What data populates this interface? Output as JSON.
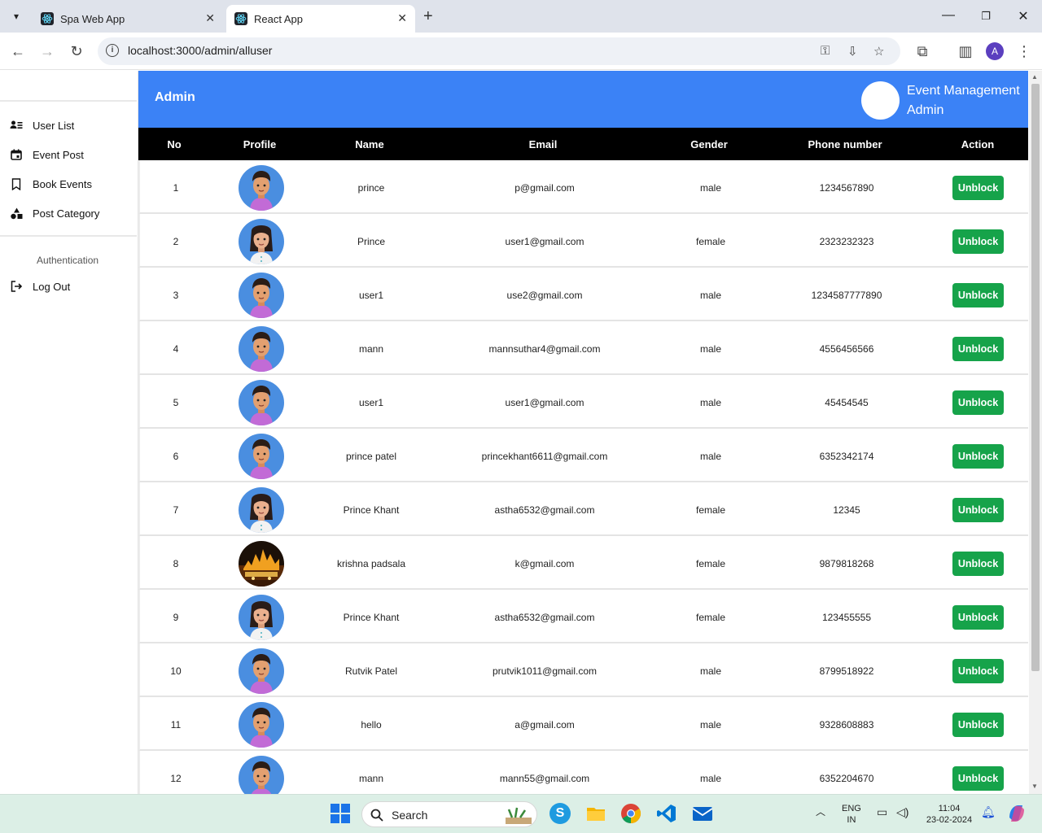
{
  "browser": {
    "tabs": [
      {
        "title": "Spa Web App",
        "active": false
      },
      {
        "title": "React App",
        "active": true
      }
    ],
    "url": "localhost:3000/admin/alluser",
    "profile_initial": "A"
  },
  "sidebar": {
    "items": [
      {
        "label": "User List",
        "icon": "user-list-icon"
      },
      {
        "label": "Event Post",
        "icon": "calendar-icon"
      },
      {
        "label": "Book Events",
        "icon": "bookmark-icon"
      },
      {
        "label": "Post Category",
        "icon": "shapes-icon"
      }
    ],
    "section_label": "Authentication",
    "logout_label": "Log Out"
  },
  "header": {
    "title": "Admin",
    "brand_line1": "Event Management",
    "brand_line2": "Admin"
  },
  "table": {
    "columns": [
      "No",
      "Profile",
      "Name",
      "Email",
      "Gender",
      "Phone number",
      "Action"
    ],
    "action_label": "Unblock",
    "rows": [
      {
        "no": "1",
        "avatar": "boy",
        "name": "prince",
        "email": "p@gmail.com",
        "gender": "male",
        "phone": "1234567890"
      },
      {
        "no": "2",
        "avatar": "girl",
        "name": "Prince",
        "email": "user1@gmail.com",
        "gender": "female",
        "phone": "2323232323"
      },
      {
        "no": "3",
        "avatar": "boy",
        "name": "user1",
        "email": "use2@gmail.com",
        "gender": "male",
        "phone": "1234587777890"
      },
      {
        "no": "4",
        "avatar": "boy",
        "name": "mann",
        "email": "mannsuthar4@gmail.com",
        "gender": "male",
        "phone": "4556456566"
      },
      {
        "no": "5",
        "avatar": "boy",
        "name": "user1",
        "email": "user1@gmail.com",
        "gender": "male",
        "phone": "45454545"
      },
      {
        "no": "6",
        "avatar": "boy",
        "name": "prince patel",
        "email": "princekhant6611@gmail.com",
        "gender": "male",
        "phone": "6352342174"
      },
      {
        "no": "7",
        "avatar": "girl",
        "name": "Prince Khant",
        "email": "astha6532@gmail.com",
        "gender": "female",
        "phone": "12345"
      },
      {
        "no": "8",
        "avatar": "photo",
        "name": "krishna padsala",
        "email": "k@gmail.com",
        "gender": "female",
        "phone": "9879818268"
      },
      {
        "no": "9",
        "avatar": "girl",
        "name": "Prince Khant",
        "email": "astha6532@gmail.com",
        "gender": "female",
        "phone": "123455555"
      },
      {
        "no": "10",
        "avatar": "boy",
        "name": "Rutvik Patel",
        "email": "prutvik1011@gmail.com",
        "gender": "male",
        "phone": "8799518922"
      },
      {
        "no": "11",
        "avatar": "boy",
        "name": "hello",
        "email": "a@gmail.com",
        "gender": "male",
        "phone": "9328608883"
      },
      {
        "no": "12",
        "avatar": "boy",
        "name": "mann",
        "email": "mann55@gmail.com",
        "gender": "male",
        "phone": "6352204670"
      }
    ]
  },
  "taskbar": {
    "search_label": "Search",
    "lang_line1": "ENG",
    "lang_line2": "IN",
    "time": "11:04",
    "date": "23-02-2024"
  },
  "colors": {
    "header_bg": "#3b82f6",
    "table_head_bg": "#000000",
    "action_button": "#16a34a"
  }
}
